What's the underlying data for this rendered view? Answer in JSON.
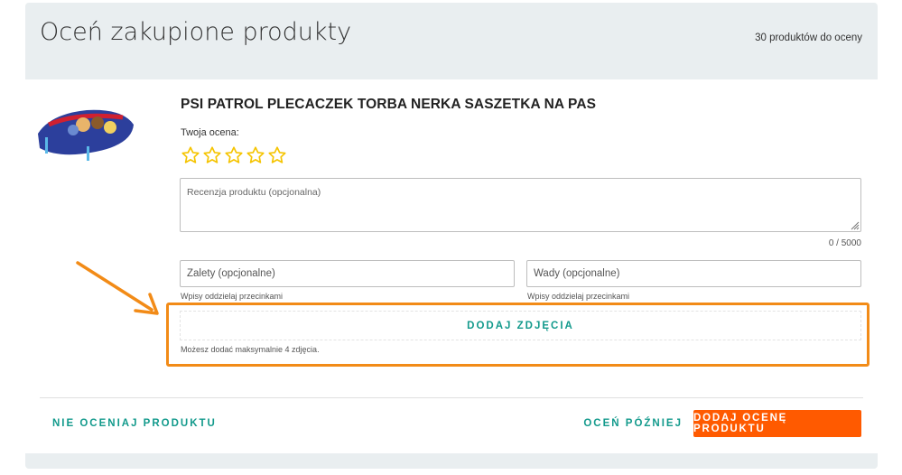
{
  "header": {
    "title": "Oceń zakupione produkty",
    "products_count": "30 produktów do oceny"
  },
  "product": {
    "name": "PSI PATROL PLECACZEK TORBA NERKA SASZETKA NA PAS",
    "image_icon": "product-thumbnail"
  },
  "rating": {
    "label": "Twoja ocena:",
    "stars_total": 5,
    "stars_selected": 0,
    "star_color": "#f5c400"
  },
  "review": {
    "placeholder": "Recenzja produktu (opcjonalna)",
    "char_count": "0 / 5000"
  },
  "pros": {
    "placeholder": "Zalety (opcjonalne)",
    "hint": "Wpisy oddzielaj przecinkami"
  },
  "cons": {
    "placeholder": "Wady (opcjonalne)",
    "hint": "Wpisy oddzielaj przecinkami"
  },
  "photos": {
    "button_label": "DODAJ ZDJĘCIA",
    "note": "Możesz dodać maksymalnie 4 zdjęcia."
  },
  "footer": {
    "skip_label": "NIE OCENIAJ PRODUKTU",
    "later_label": "OCEŃ PÓŹNIEJ",
    "submit_label": "DODAJ OCENĘ PRODUKTU"
  },
  "colors": {
    "accent_teal": "#139a8c",
    "submit_orange": "#ff5a00",
    "highlight_orange": "#f28b17",
    "panel_background": "#e9eef0"
  }
}
